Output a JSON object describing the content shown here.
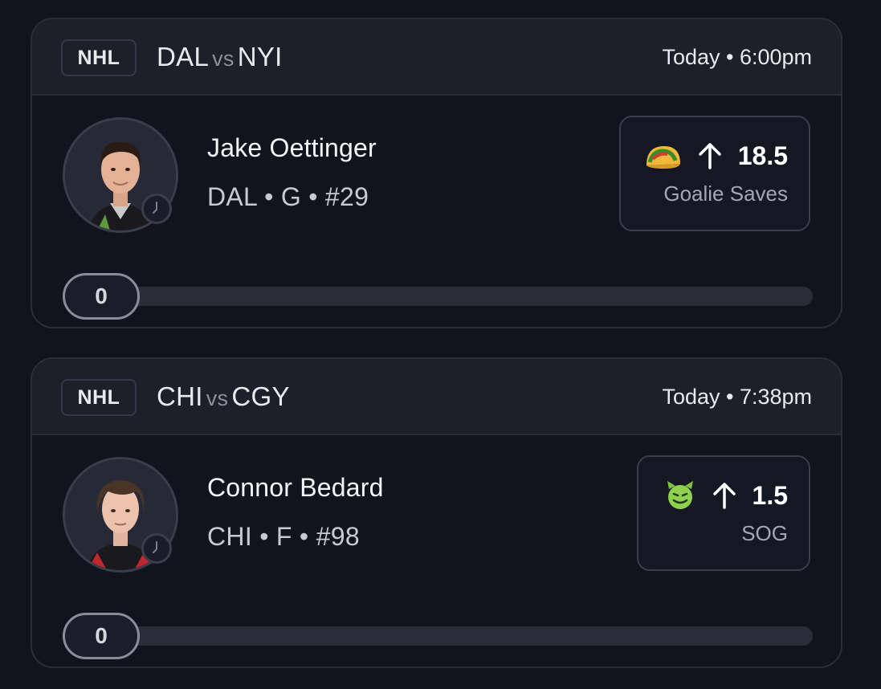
{
  "cards": [
    {
      "league": "NHL",
      "home_team": "DAL",
      "vs": "vs",
      "away_team": "NYI",
      "time": "Today • 6:00pm",
      "player_name": "Jake Oettinger",
      "player_info": "DAL • G • #29",
      "prop_emoji": "taco-icon",
      "direction": "up-arrow-icon",
      "line": "18.5",
      "stat": "Goalie Saves",
      "progress_value": "0",
      "progress_fraction": 0
    },
    {
      "league": "NHL",
      "home_team": "CHI",
      "vs": "vs",
      "away_team": "CGY",
      "time": "Today • 7:38pm",
      "player_name": "Connor Bedard",
      "player_info": "CHI • F • #98",
      "prop_emoji": "green-devil-icon",
      "direction": "up-arrow-icon",
      "line": "1.5",
      "stat": "SOG",
      "progress_value": "0",
      "progress_fraction": 0
    }
  ],
  "colors": {
    "background": "#11141d",
    "header": "#1d1f29",
    "border": "#2b2e39",
    "track": "#2a2d38"
  }
}
